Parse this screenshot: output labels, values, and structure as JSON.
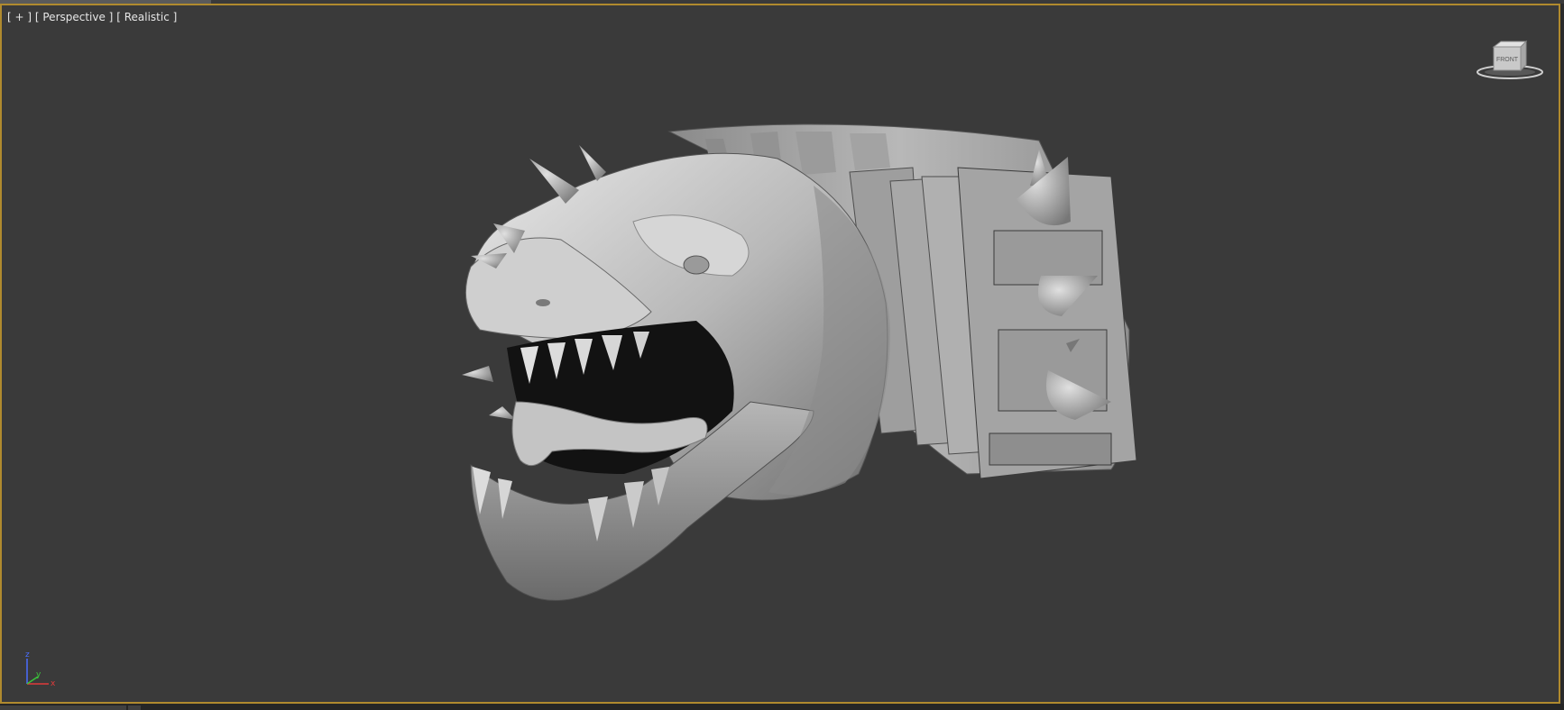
{
  "viewport": {
    "label_parts": [
      "[ + ]",
      "[ Perspective ]",
      "[ Realistic ]"
    ],
    "border_color": "#b08a2e",
    "background_color": "#3a3a3a"
  },
  "viewcube": {
    "face_label": "FRONT",
    "icon": "viewcube-icon"
  },
  "axis_gizmo": {
    "axes": [
      "z",
      "y",
      "x"
    ],
    "colors": {
      "z": "#4a6dff",
      "y": "#3ac43a",
      "x": "#e03a3a"
    }
  },
  "scene": {
    "object_icon": "monster-head-model"
  }
}
